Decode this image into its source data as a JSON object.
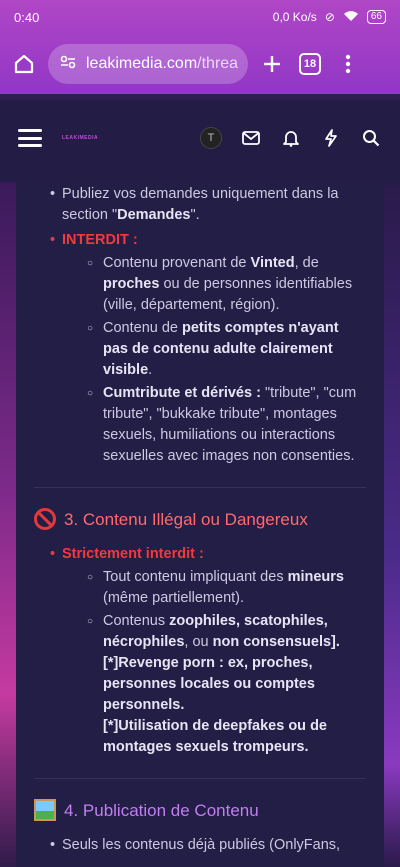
{
  "status": {
    "time": "0:40",
    "network": "0,0 Ko/s",
    "battery": "66"
  },
  "browser": {
    "url_host": "leakimedia.com",
    "url_path": "/threa",
    "tabs_count": "18"
  },
  "site": {
    "logo_text": "LEAKIMEDIA",
    "avatar_letter": "T"
  },
  "content": {
    "top_bullet": {
      "prefix": "Publiez vos demandes uniquement dans la section \"",
      "strong": "Demandes",
      "suffix": "\"."
    },
    "interdit_label": "INTERDIT :",
    "interdit_items": [
      {
        "parts": [
          [
            "t",
            "Contenu provenant de "
          ],
          [
            "b",
            "Vinted"
          ],
          [
            "t",
            ", de "
          ],
          [
            "b",
            "proches"
          ],
          [
            "t",
            " ou de personnes identifiables (ville, département, région)."
          ]
        ]
      },
      {
        "parts": [
          [
            "t",
            "Contenu de "
          ],
          [
            "b",
            "petits comptes n'ayant pas de contenu adulte clairement visible"
          ],
          [
            "t",
            "."
          ]
        ]
      },
      {
        "parts": [
          [
            "b",
            "Cumtribute et dérivés :"
          ],
          [
            "t",
            " \"tribute\", \"cum tribute\", \"bukkake tribute\", montages sexuels, humiliations ou interactions sexuelles avec images non consenties."
          ]
        ]
      }
    ],
    "section3_title": "3. Contenu Illégal ou Dangereux",
    "strict_label": "Strictement interdit :",
    "strict_items": [
      {
        "parts": [
          [
            "t",
            "Tout contenu impliquant des "
          ],
          [
            "b",
            "mineurs"
          ],
          [
            "t",
            " (même partiellement)."
          ]
        ]
      },
      {
        "parts": [
          [
            "t",
            "Contenus "
          ],
          [
            "b",
            "zoophiles, scatophiles, nécrophiles"
          ],
          [
            "t",
            ", ou "
          ],
          [
            "b",
            "non consensuels]."
          ]
        ]
      }
    ],
    "strict_extra": [
      "[*]Revenge porn : ex, proches, personnes locales ou comptes personnels.",
      "[*]Utilisation de deepfakes ou de montages sexuels trompeurs."
    ],
    "section4_title": "4. Publication de Contenu",
    "section4_first_line": "Seuls les contenus déjà publiés (OnlyFans,"
  }
}
